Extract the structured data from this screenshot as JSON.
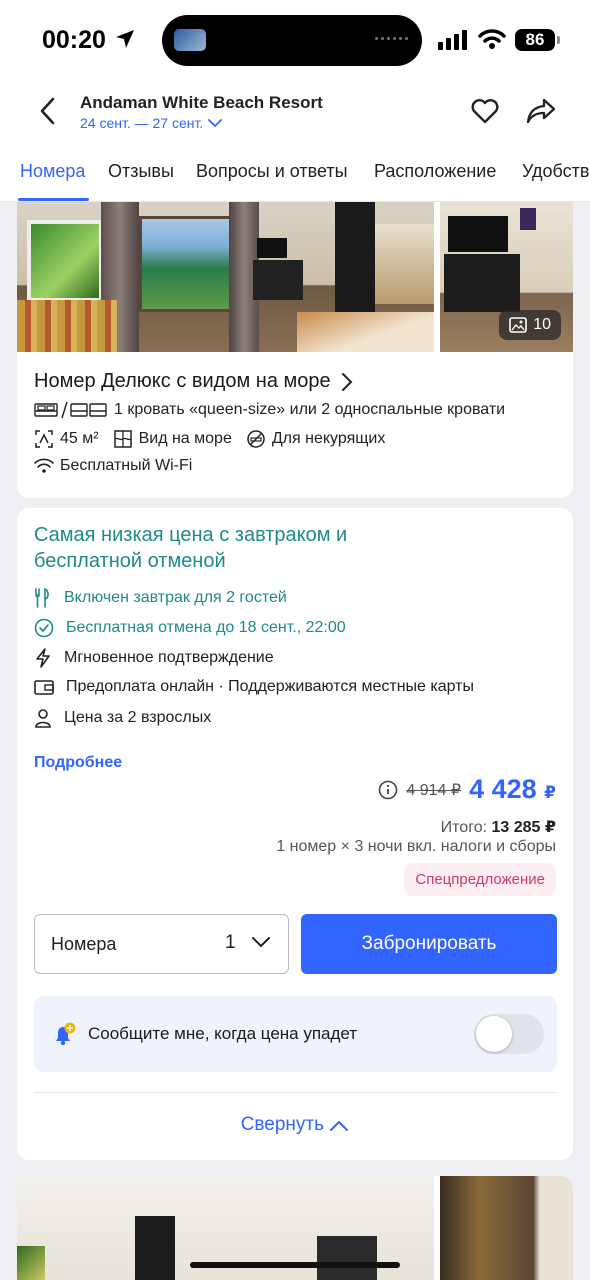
{
  "status": {
    "time": "00:20",
    "battery": "86"
  },
  "header": {
    "hotel_name": "Andaman White Beach Resort",
    "dates": "24 сент. — 27 сент."
  },
  "tabs": [
    {
      "label": "Номера",
      "active": true
    },
    {
      "label": "Отзывы"
    },
    {
      "label": "Вопросы и ответы"
    },
    {
      "label": "Расположение"
    },
    {
      "label": "Удобства"
    }
  ],
  "room": {
    "photo_count": "10",
    "title": "Номер Делюкс с видом на море",
    "beds": "1 кровать «queen-size» или 2 односпальные кровати",
    "area": "45 м²",
    "view": "Вид на море",
    "smoking": "Для некурящих",
    "wifi": "Бесплатный Wi-Fi"
  },
  "offer": {
    "title": "Самая низкая цена с завтраком и бесплатной отменой",
    "features": [
      {
        "text": "Включен завтрак для 2 гостей",
        "icon": "fork-knife-icon"
      },
      {
        "text": "Бесплатная отмена до 18 сент., 22:00",
        "icon": "check-circle-icon"
      },
      {
        "text": "Мгновенное подтверждение",
        "icon": "lightning-icon"
      },
      {
        "text": "Предоплата онлайн · Поддерживаются местные карты",
        "icon": "wallet-icon"
      },
      {
        "text": "Цена за 2 взрослых",
        "icon": "person-icon"
      }
    ],
    "more_link": "Подробнее",
    "old_price": "4 914 ₽",
    "new_price": "4 428",
    "currency": "₽",
    "total_label": "Итого:",
    "total_value": "13 285 ₽",
    "nights_note": "1 номер × 3 ночи вкл. налоги и сборы",
    "special_badge": "Спецпредложение",
    "rooms_label": "Номера",
    "rooms_value": "1",
    "book_button": "Забронировать",
    "price_alert": "Сообщите мне, когда цена упадет",
    "price_alert_on": false,
    "collapse": "Свернуть"
  },
  "colors": {
    "accent": "#3264ff",
    "teal": "#1e8a8a",
    "special": "#d03a68"
  }
}
